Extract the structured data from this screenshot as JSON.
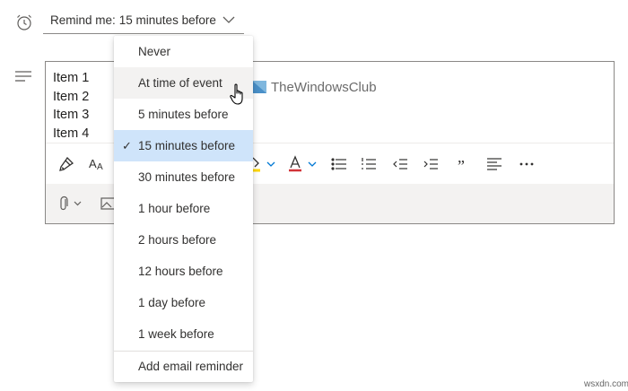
{
  "reminder": {
    "label": "Remind me:",
    "value": "15 minutes before",
    "options": [
      {
        "label": "Never"
      },
      {
        "label": "At time of event"
      },
      {
        "label": "5 minutes before"
      },
      {
        "label": "15 minutes before"
      },
      {
        "label": "30 minutes before"
      },
      {
        "label": "1 hour before"
      },
      {
        "label": "2 hours before"
      },
      {
        "label": "12 hours before"
      },
      {
        "label": "1 day before"
      },
      {
        "label": "1 week before"
      }
    ],
    "hovered": "At time of event",
    "selected": "15 minutes before",
    "add_email_label": "Add email reminder"
  },
  "notes": {
    "lines": [
      "Item 1",
      "Item 2",
      "Item 3",
      "Item 4"
    ]
  },
  "watermark": "TheWindowsClub",
  "site_watermark": "wsxdn.com",
  "colors": {
    "selected_bg": "#cfe4fa",
    "hover_bg": "#f3f2f1",
    "highlight_yellow": "#ffd700",
    "font_color_red": "#d13438",
    "accent": "#0078d4"
  }
}
